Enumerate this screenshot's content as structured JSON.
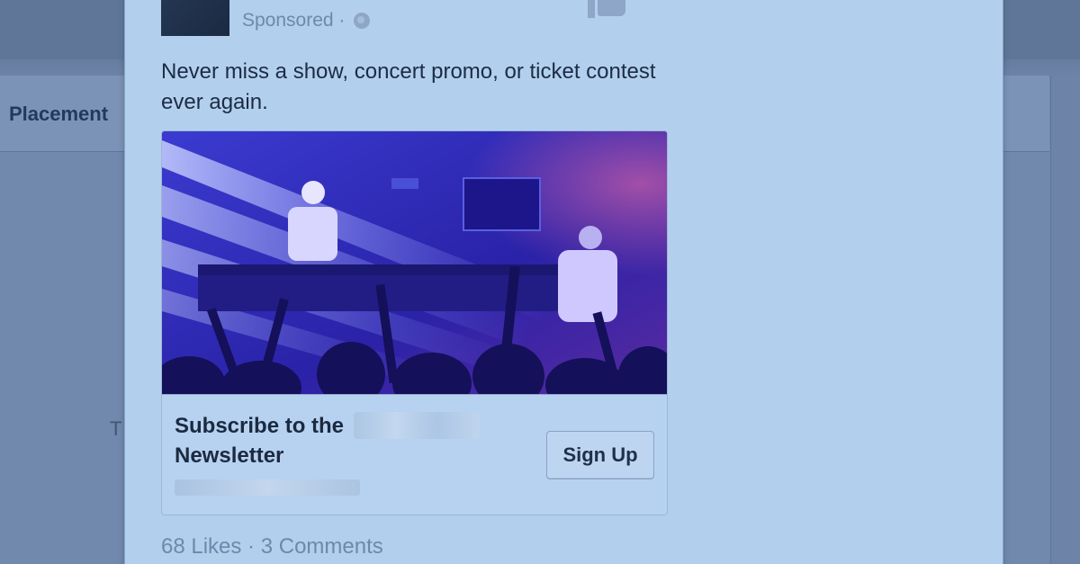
{
  "background": {
    "placement_label": "Placement",
    "partial_letter": "T"
  },
  "post": {
    "sponsored_label": "Sponsored ·",
    "body_text": "Never miss a show, concert promo, or ticket contest ever again.",
    "engagement": "68 Likes · 3 Comments",
    "attachment": {
      "title_prefix": "Subscribe to the",
      "title_suffix": "Newsletter",
      "cta_label": "Sign Up"
    }
  },
  "icons": {
    "globe": "globe-icon",
    "like": "like-thumb-icon"
  },
  "colors": {
    "overlay_tint": "#b2cfee",
    "text_dark": "#1c2c44",
    "text_muted": "#6f88ab"
  }
}
